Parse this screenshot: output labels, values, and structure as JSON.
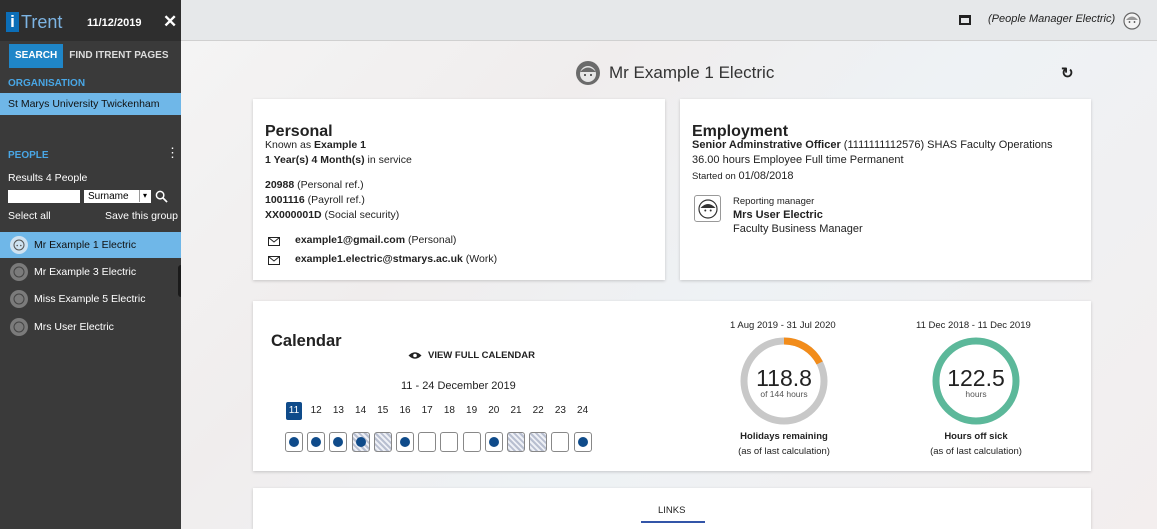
{
  "sidebar": {
    "logo_i": "i",
    "logo_text": "Trent",
    "date": "11/12/2019",
    "close_icon": "close-icon",
    "tabs": [
      {
        "label": "SEARCH",
        "active": true
      },
      {
        "label": "FIND ITRENT PAGES",
        "active": false
      }
    ],
    "organisation_label": "ORGANISATION",
    "organisation_value": "St Marys University Twickenham",
    "people_label": "PEOPLE",
    "results": "Results 4 People",
    "search_value": "",
    "search_by": "Surname",
    "select_all": "Select all",
    "save_group": "Save this group",
    "people": [
      {
        "name": "Mr Example 1 Electric",
        "active": true
      },
      {
        "name": "Mr Example 3 Electric",
        "active": false
      },
      {
        "name": "Miss Example 5 Electric",
        "active": false
      },
      {
        "name": "Mrs User Electric",
        "active": false
      }
    ]
  },
  "topbar": {
    "role": "(People Manager Electric)"
  },
  "header": {
    "name": "Mr Example 1 Electric"
  },
  "personal": {
    "title": "Personal",
    "known_as_prefix": "Known as ",
    "known_as": "Example 1",
    "service": "1 Year(s) 4 Month(s)",
    "service_suffix": " in service",
    "personal_ref": "20988",
    "personal_ref_label": " (Personal ref.)",
    "payroll_ref": "1001116",
    "payroll_ref_label": " (Payroll ref.)",
    "social_security": "XX000001D",
    "social_security_label": " (Social security)",
    "email_personal": "example1@gmail.com",
    "email_personal_label": " (Personal)",
    "email_work": "example1.electric@stmarys.ac.uk",
    "email_work_label": " (Work)"
  },
  "employment": {
    "title": "Employment",
    "job_title": "Senior Adminstrative Officer",
    "job_detail": " (1111111112576) SHAS Faculty Operations",
    "hours": "36.00 hours Employee Full time Permanent",
    "started_prefix": "Started on ",
    "started_date": "01/08/2018",
    "manager_label": "Reporting manager",
    "manager_name": "Mrs User Electric",
    "manager_role": "Faculty Business Manager"
  },
  "calendar": {
    "title": "Calendar",
    "view_full": "VIEW FULL CALENDAR",
    "range": "11 - 24 December 2019",
    "days": [
      "11",
      "12",
      "13",
      "14",
      "15",
      "16",
      "17",
      "18",
      "19",
      "20",
      "21",
      "22",
      "23",
      "24"
    ],
    "today_index": 0,
    "day_status": [
      "dot",
      "dot",
      "dot",
      "hatch-dot",
      "hatch",
      "dot",
      "empty",
      "empty",
      "empty",
      "dot",
      "hatch",
      "hatch",
      "empty",
      "dot"
    ]
  },
  "holidays": {
    "period": "1 Aug 2019 - 31 Jul 2020",
    "value": "118.8",
    "sub": "of 144 hours",
    "used_fraction": 0.175,
    "label": "Holidays remaining",
    "note": "(as of last calculation)",
    "used_color": "#f28c1a",
    "track_color": "#c8c8c8"
  },
  "sickness": {
    "period": "11 Dec 2018 - 11 Dec 2019",
    "value": "122.5",
    "sub": "hours",
    "label": "Hours off sick",
    "note": "(as of last calculation)",
    "color": "#5cb89a"
  },
  "links": {
    "tab": "LINKS"
  },
  "colors": {
    "accent": "#1f86c8",
    "navy": "#0f4b8a"
  }
}
